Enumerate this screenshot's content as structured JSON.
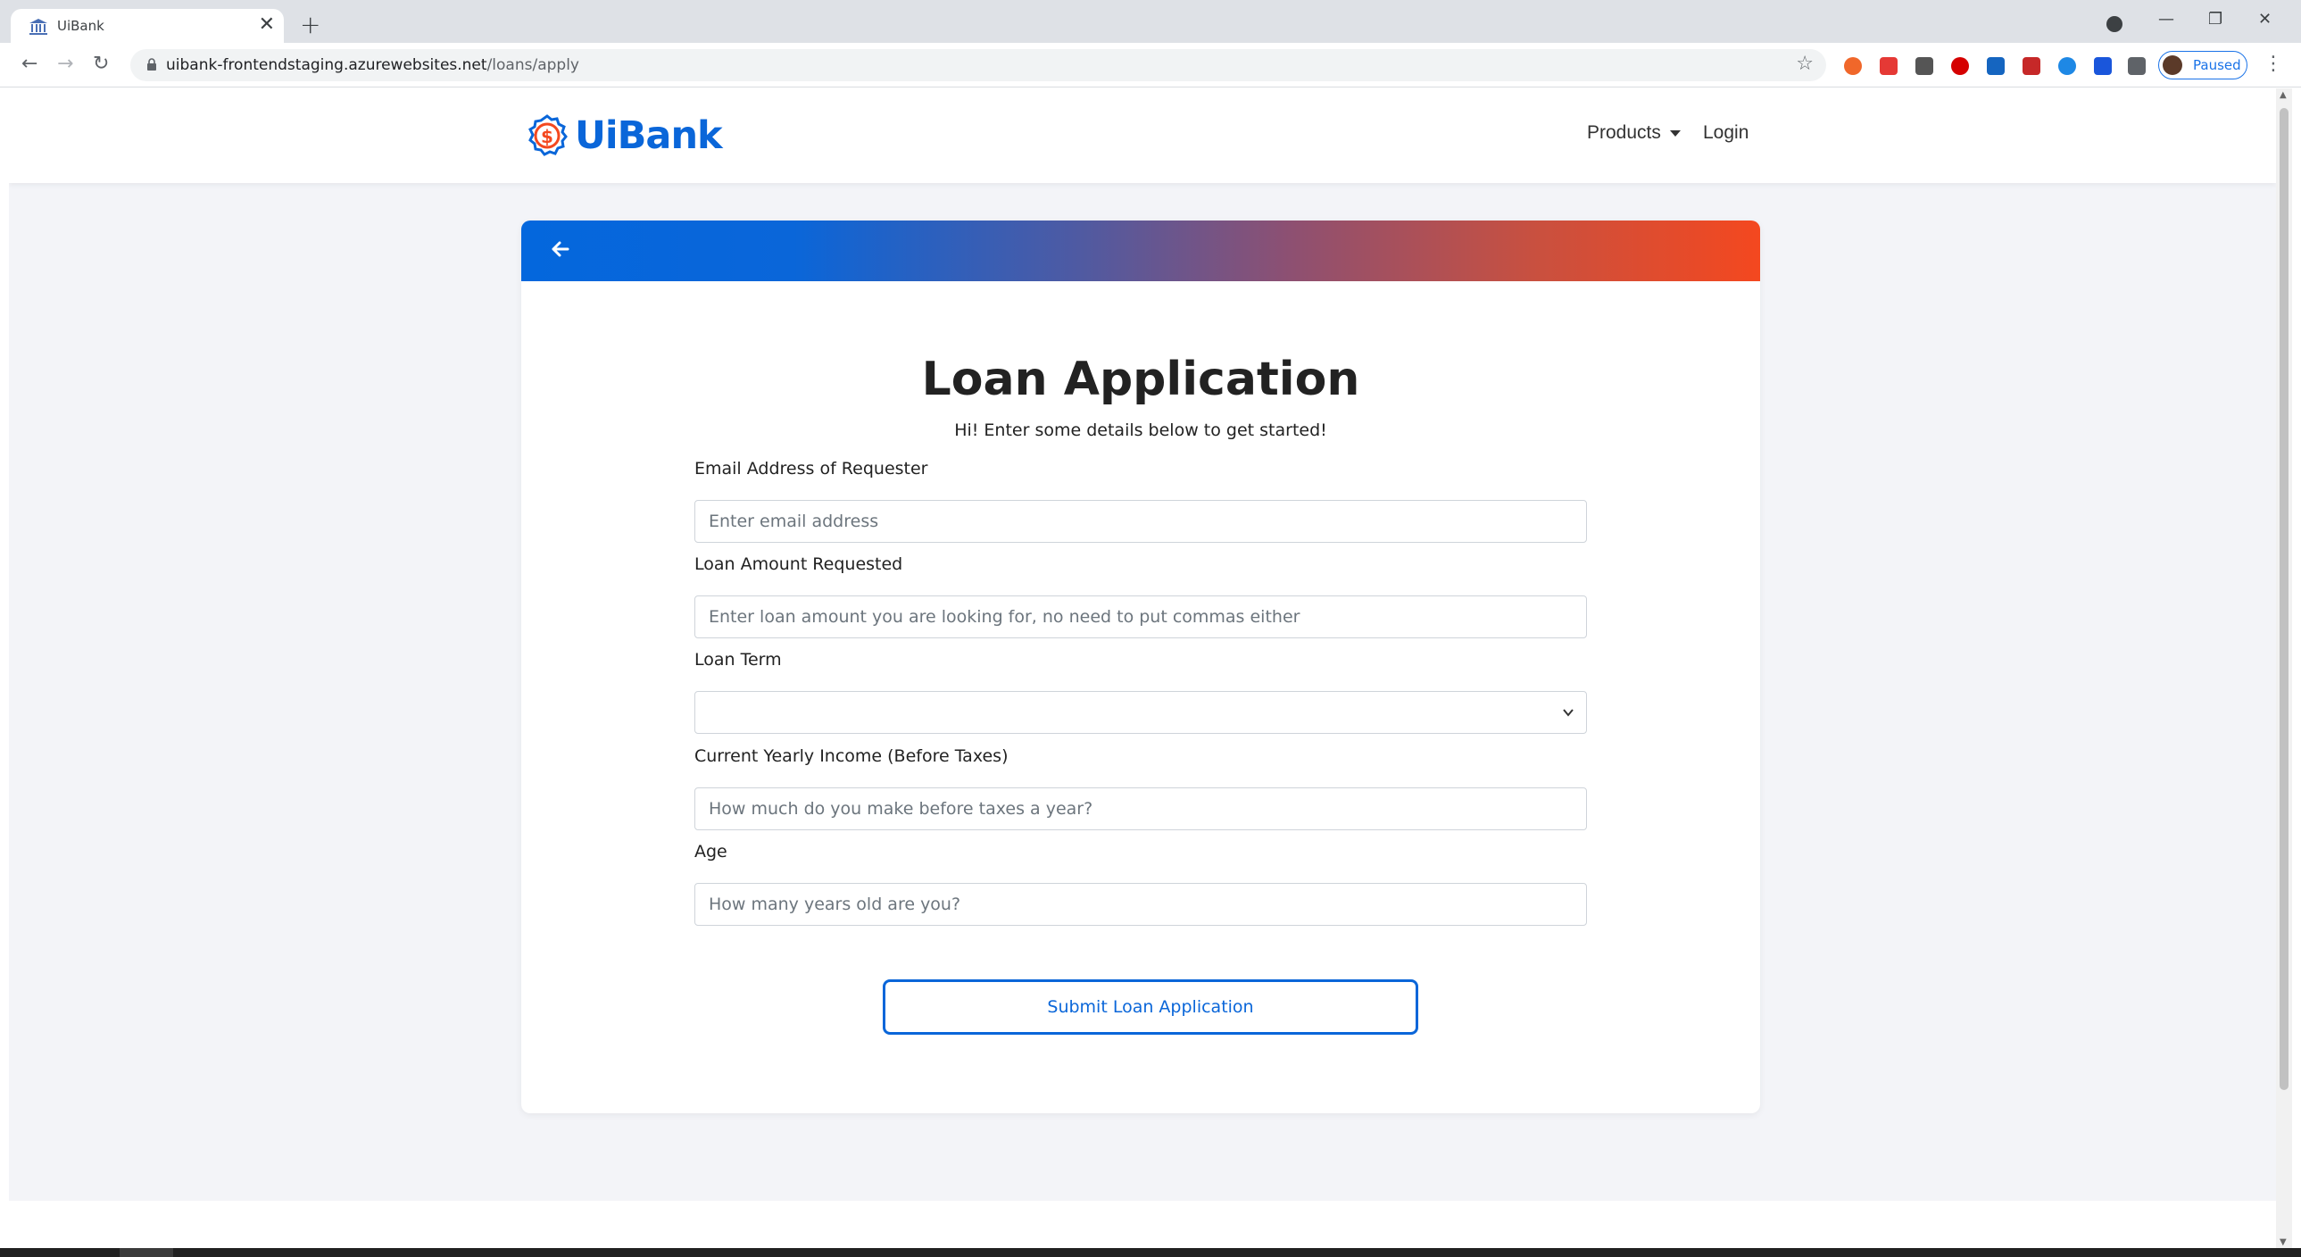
{
  "browser": {
    "tab_title": "UiBank",
    "tab_close": "✕",
    "new_tab": "+",
    "url_host": "uibank-frontendstaging.azurewebsites.net",
    "url_path": "/loans/apply",
    "profile_status": "Paused",
    "back": "←",
    "forward": "→",
    "reload": "↻",
    "star": "☆",
    "kebab": "⋮",
    "minimize": "—",
    "restore": "❐",
    "close": "✕",
    "extension_colors": [
      "#f0672a",
      "#e53935",
      "#555555",
      "#d50000",
      "#1565c0",
      "#c62828",
      "#1e88e5",
      "#1a56db",
      "#5f6368"
    ]
  },
  "site": {
    "brand": "UiBank",
    "brand_color": "#0a66d9",
    "accent_color": "#f4481f",
    "nav": {
      "products": "Products",
      "login": "Login"
    }
  },
  "form": {
    "title": "Loan Application",
    "subtitle": "Hi! Enter some details below to get started!",
    "email": {
      "label": "Email Address of Requester",
      "placeholder": "Enter email address",
      "value": ""
    },
    "amount": {
      "label": "Loan Amount Requested",
      "placeholder": "Enter loan amount you are looking for, no need to put commas either",
      "value": ""
    },
    "term": {
      "label": "Loan Term",
      "selected": ""
    },
    "income": {
      "label": "Current Yearly Income (Before Taxes)",
      "placeholder": "How much do you make before taxes a year?",
      "value": ""
    },
    "age": {
      "label": "Age",
      "placeholder": "How many years old are you?",
      "value": ""
    },
    "submit_label": "Submit Loan Application"
  }
}
